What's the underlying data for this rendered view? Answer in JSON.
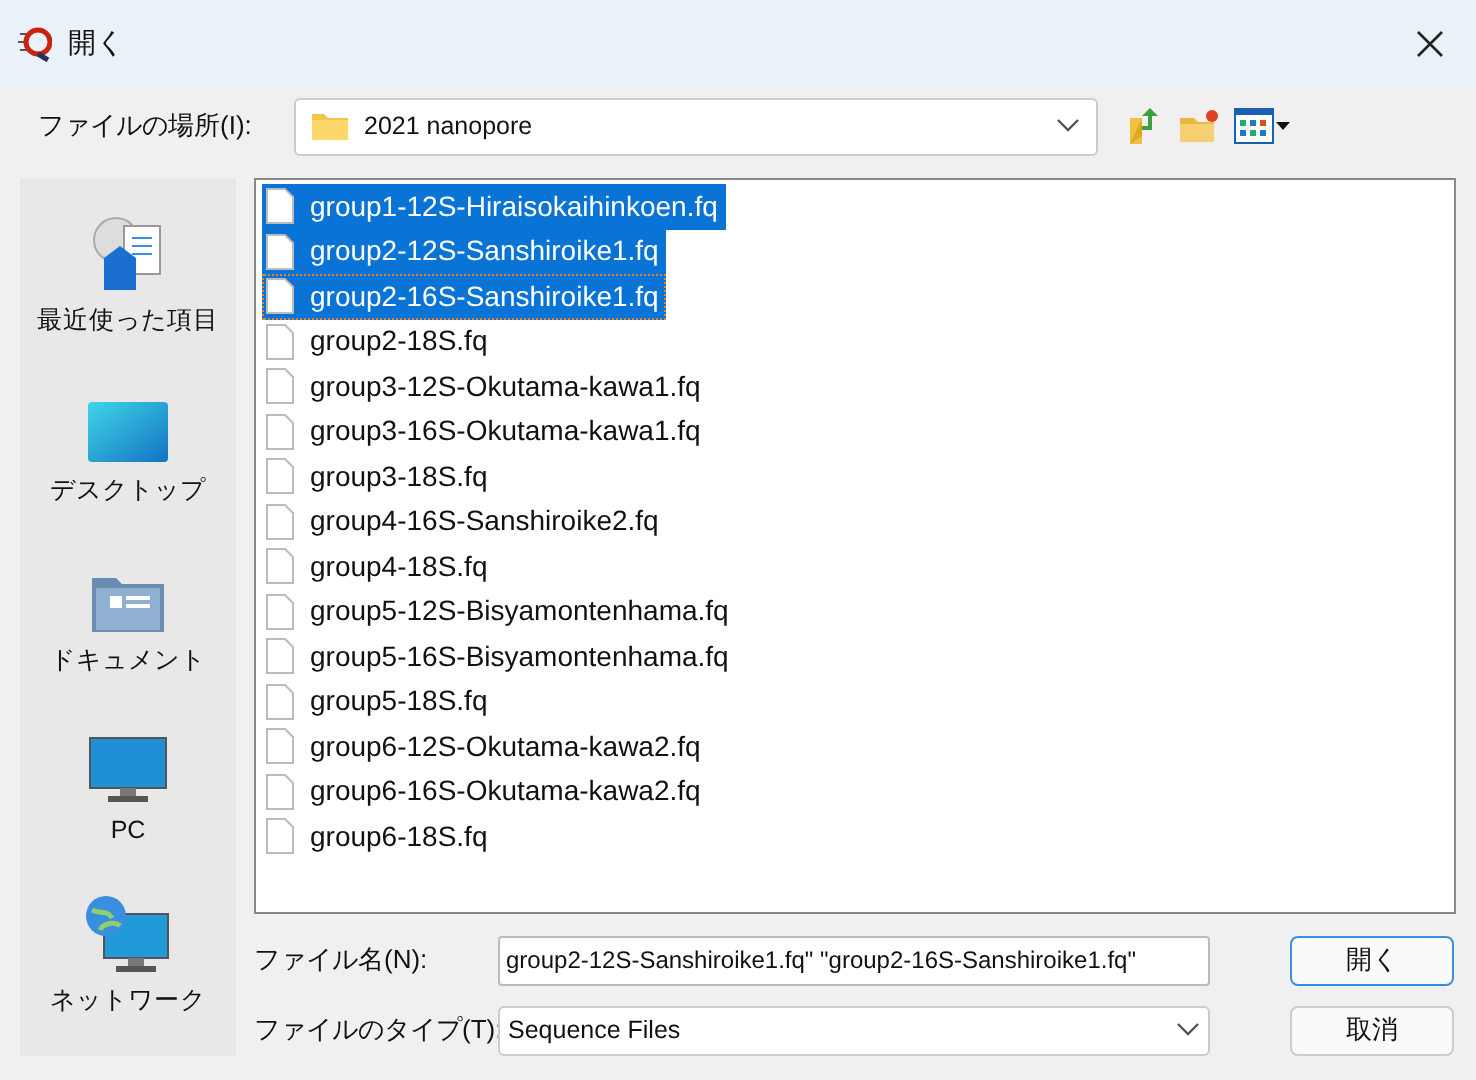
{
  "window": {
    "title": "開く"
  },
  "location": {
    "label": "ファイルの場所(I):",
    "value": "2021 nanopore"
  },
  "sidebar": {
    "items": [
      {
        "kind": "recent",
        "label": "最近使った項目"
      },
      {
        "kind": "desktop",
        "label": "デスクトップ"
      },
      {
        "kind": "documents",
        "label": "ドキュメント"
      },
      {
        "kind": "pc",
        "label": "PC"
      },
      {
        "kind": "network",
        "label": "ネットワーク"
      }
    ]
  },
  "files": [
    {
      "name": "group1-12S-Hiraisokaihinkoen.fq",
      "selected": true,
      "focused": false
    },
    {
      "name": "group2-12S-Sanshiroike1.fq",
      "selected": true,
      "focused": false
    },
    {
      "name": "group2-16S-Sanshiroike1.fq",
      "selected": true,
      "focused": true
    },
    {
      "name": "group2-18S.fq",
      "selected": false,
      "focused": false
    },
    {
      "name": "group3-12S-Okutama-kawa1.fq",
      "selected": false,
      "focused": false
    },
    {
      "name": "group3-16S-Okutama-kawa1.fq",
      "selected": false,
      "focused": false
    },
    {
      "name": "group3-18S.fq",
      "selected": false,
      "focused": false
    },
    {
      "name": "group4-16S-Sanshiroike2.fq",
      "selected": false,
      "focused": false
    },
    {
      "name": "group4-18S.fq",
      "selected": false,
      "focused": false
    },
    {
      "name": "group5-12S-Bisyamontenhama.fq",
      "selected": false,
      "focused": false
    },
    {
      "name": "group5-16S-Bisyamontenhama.fq",
      "selected": false,
      "focused": false
    },
    {
      "name": "group5-18S.fq",
      "selected": false,
      "focused": false
    },
    {
      "name": "group6-12S-Okutama-kawa2.fq",
      "selected": false,
      "focused": false
    },
    {
      "name": "group6-16S-Okutama-kawa2.fq",
      "selected": false,
      "focused": false
    },
    {
      "name": "group6-18S.fq",
      "selected": false,
      "focused": false
    }
  ],
  "filename": {
    "label": "ファイル名(N):",
    "value": "group2-12S-Sanshiroike1.fq\" \"group2-16S-Sanshiroike1.fq\""
  },
  "filetype": {
    "label": "ファイルのタイプ(T):",
    "value": "Sequence Files"
  },
  "buttons": [
    "開く",
    "取消"
  ]
}
